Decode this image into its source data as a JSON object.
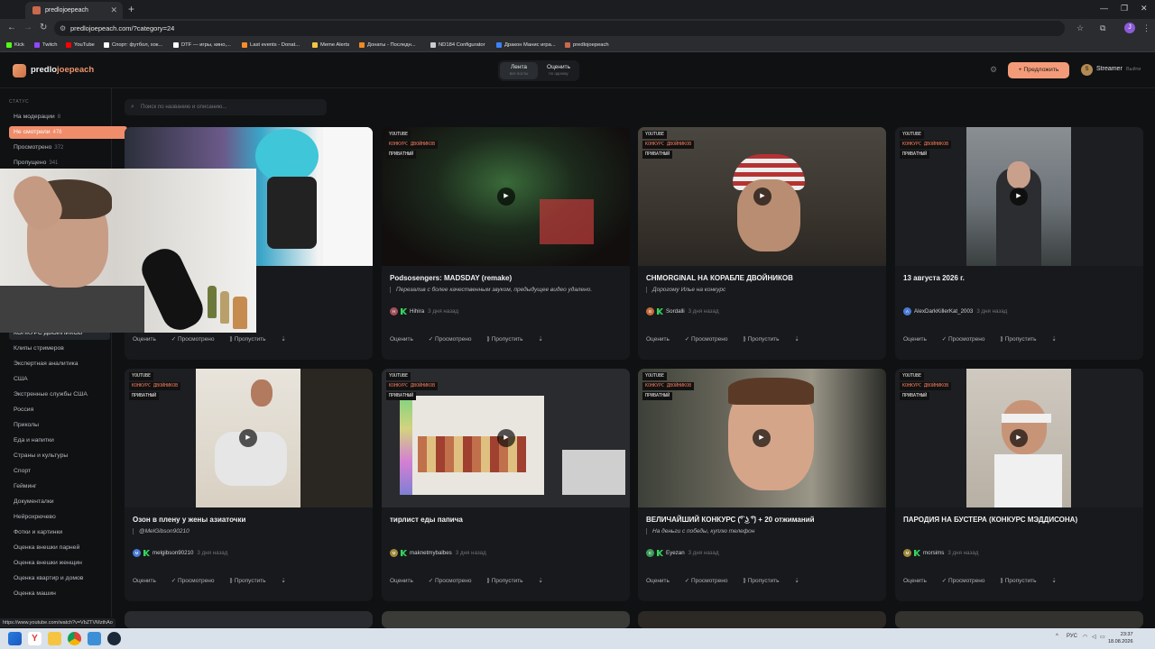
{
  "browser": {
    "tab_title": "predlojoepeach",
    "url": "predlojoepeach.com/?category=24",
    "profile_initial": "J",
    "bookmarks": [
      {
        "label": "Kick",
        "color": "#53fc18"
      },
      {
        "label": "Twitch",
        "color": "#9146ff"
      },
      {
        "label": "YouTube",
        "color": "#ff0000"
      },
      {
        "label": "Спорт: футбол, хок...",
        "color": "#ffffff"
      },
      {
        "label": "DTF — игры, кино,...",
        "color": "#ffffff"
      },
      {
        "label": "Last events - Donat...",
        "color": "#ff8c2a"
      },
      {
        "label": "Meme Alerts",
        "color": "#f5c542"
      },
      {
        "label": "Донаты - Последн...",
        "color": "#f08a24"
      },
      {
        "label": "ND184 Configurator",
        "color": "#cccccc"
      },
      {
        "label": "Дракон Манис игра...",
        "color": "#3b82f6"
      },
      {
        "label": "predlojoepeach",
        "color": "#c9694b"
      }
    ],
    "status_url": "https://www.youtube.com/watch?v=VbZTVMzthAo"
  },
  "header": {
    "logo_prefix": "predlo",
    "logo_accent": "joepeach",
    "tabs": [
      {
        "label": "Лента",
        "sub": "все посты",
        "active": true
      },
      {
        "label": "Оценить",
        "sub": "по одному",
        "active": false
      }
    ],
    "propose_label": "+ Предложить",
    "user_initial": "S",
    "user_name": "Streamer",
    "logout_label": "Выйти"
  },
  "sidebar": {
    "status_heading": "СТАТУС",
    "status_items": [
      {
        "label": "На модерации",
        "count": "8",
        "active": false
      },
      {
        "label": "Не смотрели",
        "count": "478",
        "active": true
      },
      {
        "label": "Просмотрено",
        "count": "372",
        "active": false
      },
      {
        "label": "Пропущено",
        "count": "341",
        "active": false
      }
    ],
    "selected_category": "КОНКУРС ДВОЙНИКОВ",
    "categories": [
      "Клипы стримеров",
      "Экспертная аналитика",
      "США",
      "Экстренные службы США",
      "Россия",
      "Приколы",
      "Еда и напитки",
      "Страны и культуры",
      "Спорт",
      "Гейминг",
      "Документалки",
      "Нейрохрючево",
      "Фотки и картинки",
      "Оценка внешки парней",
      "Оценка внешки женщин",
      "Оценка квартир и домов",
      "Оценка машин"
    ]
  },
  "search": {
    "placeholder": "Поиск по названию и описанию..."
  },
  "actions": {
    "rate": "Оценить",
    "watched": "✓ Просмотрено",
    "skip": "⟫ Пропустить",
    "pin": "⇣"
  },
  "badges": {
    "source": "YOUTUBE",
    "contest": "КОНКУРС ДВОЙНИКОВ",
    "private": "ПРИВАТНЫЙ"
  },
  "cards": [
    {
      "title": "",
      "desc": "",
      "author": "",
      "author_initial": "",
      "author_color": "#888888",
      "time": ""
    },
    {
      "title": "Podsosengers: MADSDAY (remake)",
      "desc": "Перезалив с более качественным звуком, предыдущее видео удалено.",
      "author": "Hihira",
      "author_initial": "H",
      "author_color": "#a0505a",
      "time": "3 дня назад"
    },
    {
      "title": "CHMORGINAL НА КОРАБЛЕ ДВОЙНИКОВ",
      "desc": "Дорогому Илье на конкурс",
      "author": "Sordalli",
      "author_initial": "B",
      "author_color": "#c46a3c",
      "time": "3 дня назад"
    },
    {
      "title": "13 августа 2026 г.",
      "desc": "",
      "author": "AlexDarkKillerKat_2003",
      "author_initial": "A",
      "author_color": "#4b7bd6",
      "time": "3 дня назад"
    },
    {
      "title": "Озон в плену у жены азиаточки",
      "desc": "@MelGibson90210",
      "author": "melgibson90210",
      "author_initial": "M",
      "author_color": "#4b7bd6",
      "time": "3 дня назад"
    },
    {
      "title": "тирлист еды папича",
      "desc": "",
      "author": "maknetmybalbes",
      "author_initial": "M",
      "author_color": "#a08a3c",
      "time": "3 дня назад"
    },
    {
      "title": "ВЕЛИЧАЙШИЙ КОНКУРС (͡° ͜ʖ ͡°) + 20 отжиманий",
      "desc": "На деньги с победы, куплю телефон",
      "author": "Eyezan",
      "author_initial": "E",
      "author_color": "#3c9a5a",
      "time": "3 дня назад"
    },
    {
      "title": "ПАРОДИЯ НА БУСТЕРА (КОНКУРС МЭДДИСОНА)",
      "desc": "",
      "author": "morsims",
      "author_initial": "M",
      "author_color": "#a08a3c",
      "time": "3 дня назад"
    }
  ],
  "taskbar": {
    "lang": "РУС",
    "time": "23:37",
    "date": "18.08.2026"
  }
}
